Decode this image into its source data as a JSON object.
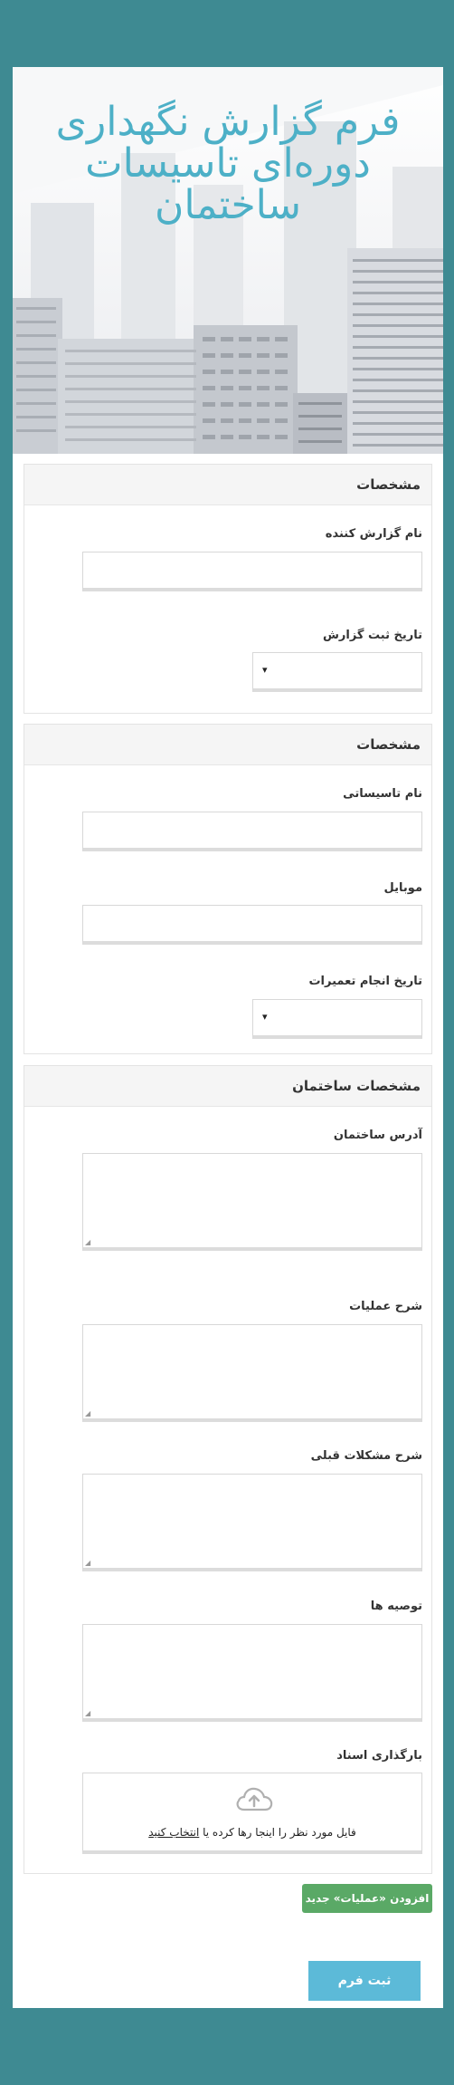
{
  "header": {
    "title": "فرم گزارش نگهداری دوره‌ای تاسیسات ساختمان"
  },
  "section1": {
    "heading": "مشخصات",
    "reporter_label": "نام گزارش کننده",
    "reporter_value": "",
    "date_label": "تاریخ ثبت گزارش",
    "date_arrow": "▾"
  },
  "section2": {
    "heading": "مشخصات",
    "facility_label": "نام تاسیساتی",
    "facility_value": "",
    "mobile_label": "موبایل",
    "mobile_value": "",
    "repair_date_label": "تاریخ انجام تعمیرات",
    "repair_date_arrow": "▾"
  },
  "section3": {
    "heading": "مشخصات ساختمان",
    "address_label": "آدرس ساختمان",
    "operations_label": "شرح عملیات",
    "prior_issues_label": "شرح مشکلات قبلی",
    "recommendations_label": "توصیه ها",
    "upload_label": "بارگذاری اسناد",
    "upload_text": "فایل مورد نظر را اینجا رها کرده یا",
    "upload_link": "انتخاب کنید"
  },
  "buttons": {
    "add_label": "افزودن «عملیات» جدید",
    "submit_label": "ثبت فرم"
  },
  "colors": {
    "page_background": "#3e8a92",
    "title": "#4db0c7",
    "add_button": "#5aa966",
    "submit_button": "#5cbad8"
  }
}
